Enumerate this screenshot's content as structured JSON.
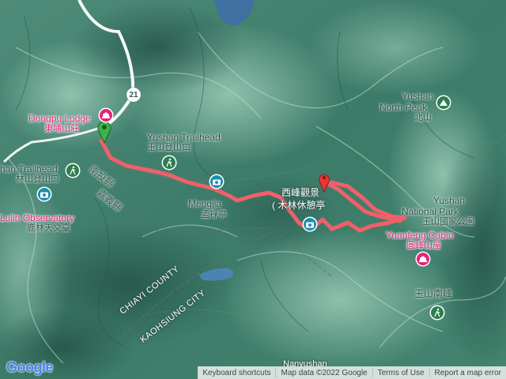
{
  "map": {
    "colors": {
      "terrain": "#3f7f6d",
      "ridge": "#8fc2ad",
      "valley": "#2a5f52",
      "track": "#f0606a",
      "road": "#ffffff",
      "water": "#3e6ea8",
      "boundary": "#6d6d6d"
    },
    "labels": {
      "dongpu_en": "Dongpu Lodge",
      "dongpu_zh": "東埔山莊",
      "trailhead_left_en": "han Trailhead",
      "trailhead_left_zh": "林山登山口",
      "yushan_trailhead_en": "Yushan Trailhead",
      "yushan_trailhead_zh": "玉山登山口",
      "nantou": "南投縣",
      "chiayi_zh": "嘉義縣",
      "lulin_en": "Lulin Observatory",
      "lulin_zh": "鹿林天文臺",
      "mengjia_en": "Mengjia",
      "mengjia_zh": "孟祿亭",
      "xifeng_1": "西峰觀景",
      "xifeng_2": "(  木林休憩亭",
      "north_peak_en_1": "Yushan",
      "north_peak_en_2": "North Peak",
      "north_peak_zh": "北山",
      "np_1": "Yushan",
      "np_2": "National Park",
      "np_zh": "玉山國家公園",
      "yuanfeng_en": "Yuanfeng Cabin",
      "yuanfeng_zh": "圓峰山屋",
      "south_peak_zh": "玉山南峰",
      "chiayi_county": "CHIAYI COUNTY",
      "kaohsiung_city": "KAOHSIUNG CITY",
      "nanyushan": "Nanyushan",
      "route_number": "21"
    },
    "icons": [
      "hiker-icon",
      "camera-icon",
      "lodge-icon",
      "peak-icon",
      "start-marker-icon",
      "end-marker-icon"
    ],
    "attribution": {
      "logo": "Google",
      "shortcuts": "Keyboard shortcuts",
      "map_data": "Map data ©2022 Google",
      "terms": "Terms of Use",
      "report": "Report a map error"
    }
  }
}
